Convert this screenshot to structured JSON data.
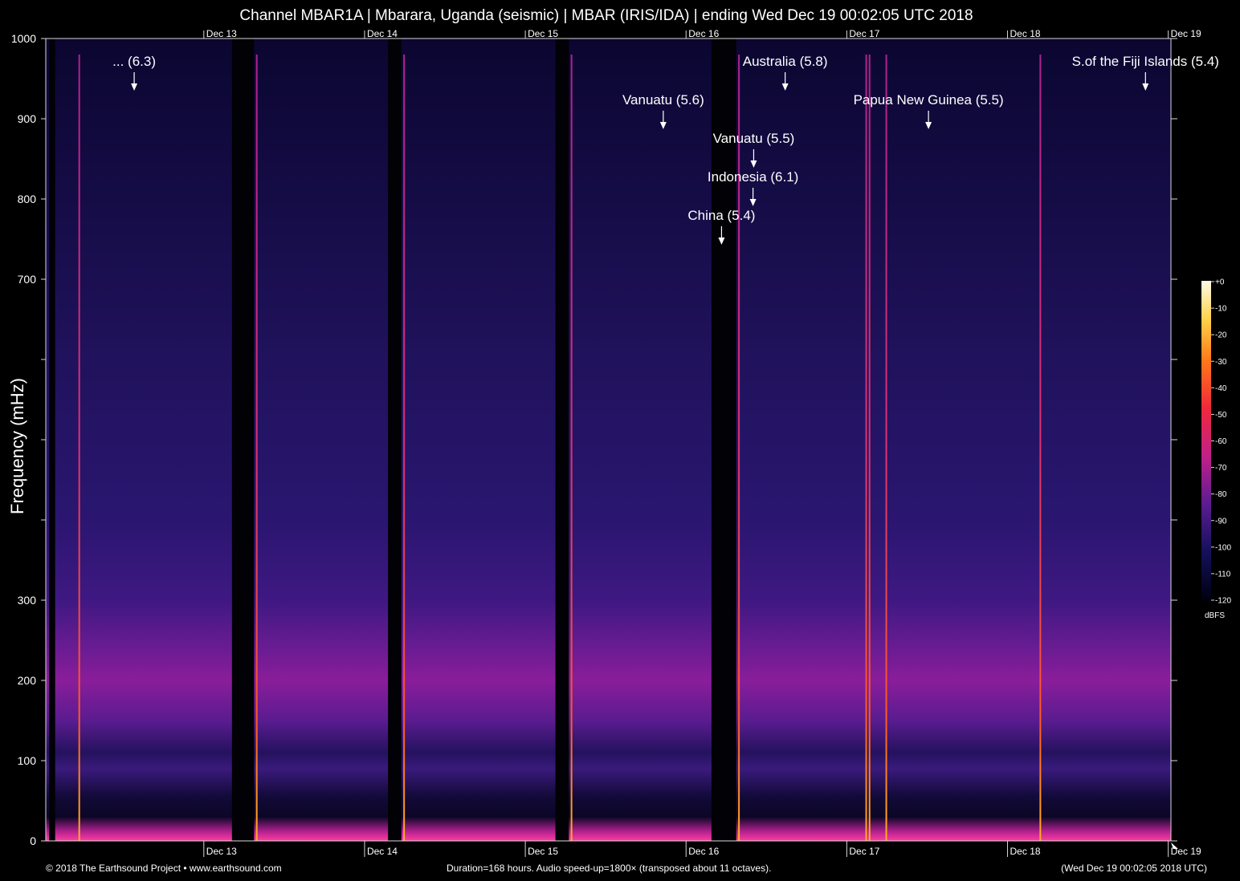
{
  "header": {
    "title": "Channel MBAR1A | Mbarara, Uganda (seismic) | MBAR (IRIS/IDA) | ending Wed Dec 19 00:02:05 UTC 2018"
  },
  "footer": {
    "copyright": "© 2018 The Earthsound Project • www.earthsound.com",
    "duration": "Duration=168 hours. Audio speed-up=1800× (transposed about 11 octaves).",
    "end_time": "(Wed Dec 19 00:02:05 2018 UTC)"
  },
  "colors": {
    "background": "#000000",
    "noise_low": "#2a1670",
    "noise_band": "#8a1d9a",
    "event_line": "#ff5a1e"
  },
  "chart_data": {
    "type": "heatmap",
    "title": "Channel MBAR1A | Mbarara, Uganda (seismic) | MBAR (IRIS/IDA) | ending Wed Dec 19 00:02:05 UTC 2018",
    "ylabel": "Frequency (mHz)",
    "xlabel": "",
    "x_unit": "hours",
    "xlim": [
      0,
      168
    ],
    "ylim": [
      0,
      1000
    ],
    "y_ticks": [
      {
        "value": 0,
        "label": "0"
      },
      {
        "value": 100,
        "label": "100"
      },
      {
        "value": 200,
        "label": "200"
      },
      {
        "value": 300,
        "label": "300"
      },
      {
        "value": 400,
        "label": ""
      },
      {
        "value": 500,
        "label": ""
      },
      {
        "value": 600,
        "label": ""
      },
      {
        "value": 700,
        "label": "700"
      },
      {
        "value": 800,
        "label": "800"
      },
      {
        "value": 900,
        "label": "900"
      },
      {
        "value": 1000,
        "label": "1000"
      }
    ],
    "x_ticks": [
      {
        "hour": 23.6,
        "label": "Dec 13"
      },
      {
        "hour": 47.6,
        "label": "Dec 14"
      },
      {
        "hour": 71.6,
        "label": "Dec 15"
      },
      {
        "hour": 95.6,
        "label": "Dec 16"
      },
      {
        "hour": 119.6,
        "label": "Dec 17"
      },
      {
        "hour": 143.6,
        "label": "Dec 18"
      },
      {
        "hour": 167.6,
        "label": "Dec 19"
      }
    ],
    "data_gaps_hours": [
      [
        0.5,
        1.4
      ],
      [
        27.8,
        31.1
      ],
      [
        51.1,
        53.1
      ],
      [
        76.1,
        78.1
      ],
      [
        99.4,
        103.1
      ]
    ],
    "vertical_event_lines_hours": [
      5.0,
      31.5,
      53.5,
      78.5,
      103.5,
      122.5,
      123.0,
      125.5,
      148.5
    ],
    "events": [
      {
        "label": "... (6.3)",
        "hour": 13.2,
        "freq": 960
      },
      {
        "label": "Australia (5.8)",
        "hour": 110.4,
        "freq": 960
      },
      {
        "label": "S.of the Fiji Islands (5.4)",
        "hour": 164.2,
        "freq": 960
      },
      {
        "label": "Vanuatu (5.6)",
        "hour": 92.2,
        "freq": 912
      },
      {
        "label": "Papua New Guinea (5.5)",
        "hour": 131.8,
        "freq": 912
      },
      {
        "label": "Vanuatu (5.5)",
        "hour": 105.7,
        "freq": 864
      },
      {
        "label": "Indonesia (6.1)",
        "hour": 105.6,
        "freq": 816
      },
      {
        "label": "China (5.4)",
        "hour": 100.9,
        "freq": 768
      }
    ],
    "colorbar": {
      "ticks": [
        "+0",
        "-10",
        "-20",
        "-30",
        "-40",
        "-50",
        "-60",
        "-70",
        "-80",
        "-90",
        "-100",
        "-110",
        "-120"
      ],
      "unit": "dBFS",
      "range": [
        -120,
        0
      ]
    },
    "grid": false
  }
}
